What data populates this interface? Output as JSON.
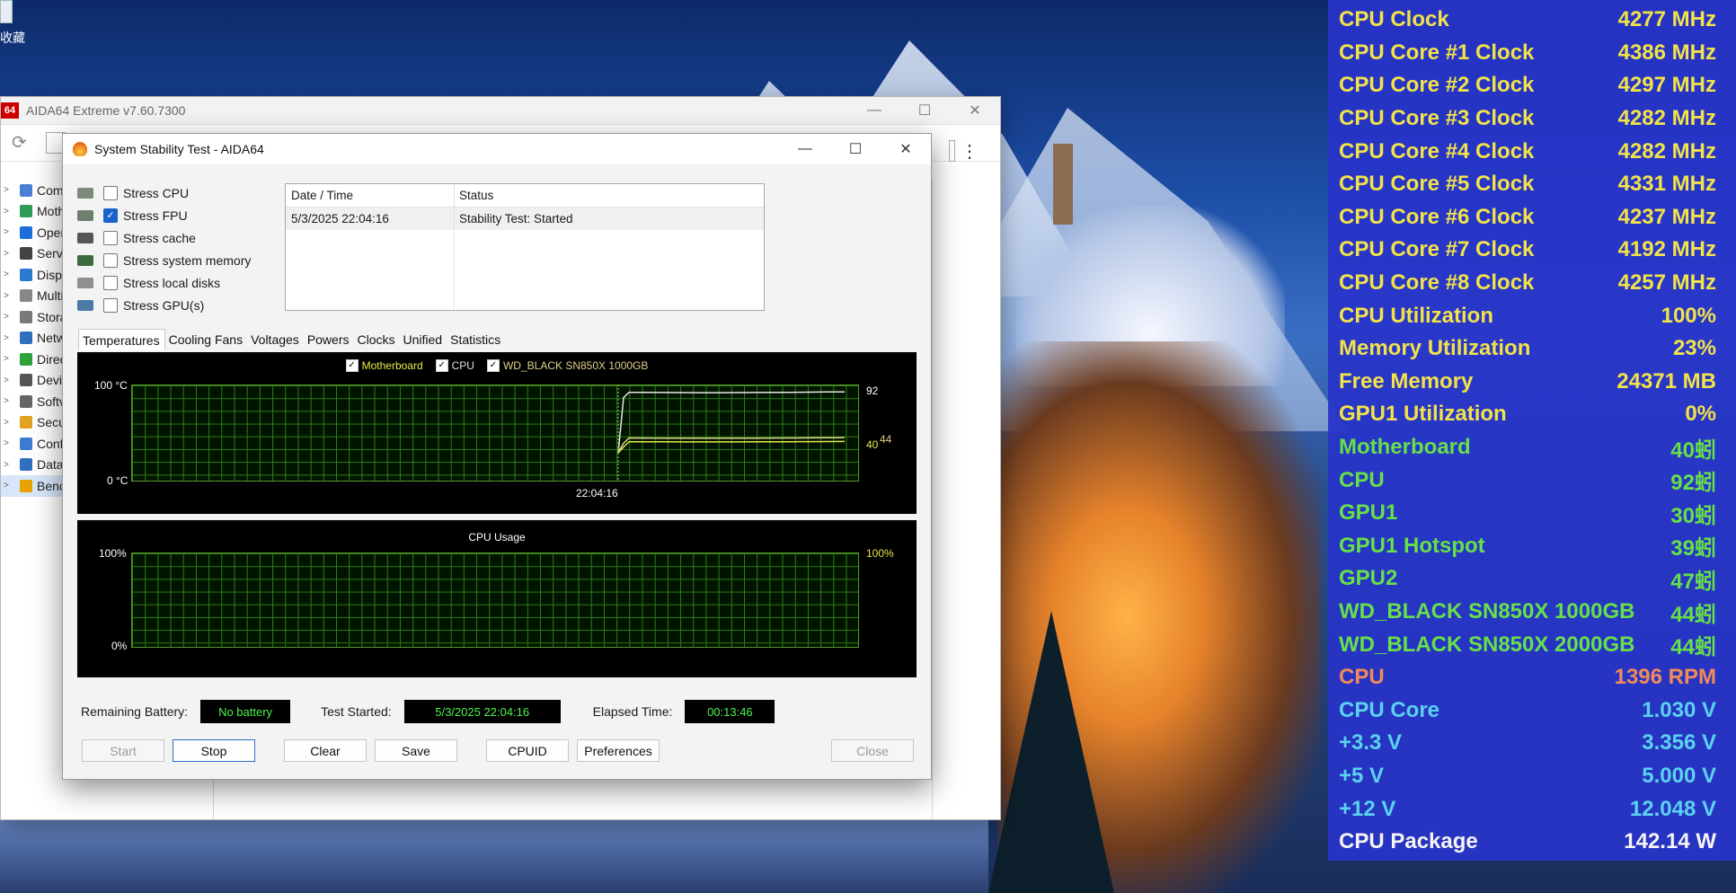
{
  "desktop": {
    "icon_label": "收藏"
  },
  "main_window": {
    "title": "AIDA64 Extreme v7.60.7300",
    "logo_text": "64",
    "tree_items": [
      "Com",
      "Moth",
      "Oper",
      "Serv",
      "Displ",
      "Multi",
      "Stora",
      "Netw",
      "Direc",
      "Devi",
      "Softv",
      "Secu",
      "Conf",
      "Data",
      "Benc"
    ]
  },
  "dialog": {
    "title": "System Stability Test - AIDA64",
    "options": [
      {
        "label": "Stress CPU",
        "checked": false
      },
      {
        "label": "Stress FPU",
        "checked": true
      },
      {
        "label": "Stress cache",
        "checked": false
      },
      {
        "label": "Stress system memory",
        "checked": false
      },
      {
        "label": "Stress local disks",
        "checked": false
      },
      {
        "label": "Stress GPU(s)",
        "checked": false
      }
    ],
    "log": {
      "col_datetime": "Date / Time",
      "col_status": "Status",
      "row_datetime": "5/3/2025 22:04:16",
      "row_status": "Stability Test: Started"
    },
    "tabs": [
      "Temperatures",
      "Cooling Fans",
      "Voltages",
      "Powers",
      "Clocks",
      "Unified",
      "Statistics"
    ],
    "temp_graph": {
      "legend": [
        "Motherboard",
        "CPU",
        "WD_BLACK SN850X 1000GB"
      ],
      "y_max": "100 °C",
      "y_min": "0 °C",
      "time": "22:04:16",
      "val_cpu": "92",
      "val_mb": "40",
      "val_ssd": "44",
      "colors": {
        "motherboard": "#e8e84a",
        "cpu": "#e0e0e0",
        "ssd": "#e0d08a"
      }
    },
    "usage_graph": {
      "title": "CPU Usage",
      "y_max": "100%",
      "y_min": "0%",
      "value": "100%"
    },
    "status": {
      "battery_label": "Remaining Battery:",
      "battery_value": "No battery",
      "started_label": "Test Started:",
      "started_value": "5/3/2025 22:04:16",
      "elapsed_label": "Elapsed Time:",
      "elapsed_value": "00:13:46"
    },
    "buttons": {
      "start": "Start",
      "stop": "Stop",
      "clear": "Clear",
      "save": "Save",
      "cpuid": "CPUID",
      "preferences": "Preferences",
      "close": "Close"
    }
  },
  "osd": [
    {
      "label": "CPU Clock",
      "value": "4277 MHz",
      "color": "#f2e24a"
    },
    {
      "label": "CPU Core #1 Clock",
      "value": "4386 MHz",
      "color": "#f2e24a"
    },
    {
      "label": "CPU Core #2 Clock",
      "value": "4297 MHz",
      "color": "#f2e24a"
    },
    {
      "label": "CPU Core #3 Clock",
      "value": "4282 MHz",
      "color": "#f2e24a"
    },
    {
      "label": "CPU Core #4 Clock",
      "value": "4282 MHz",
      "color": "#f2e24a"
    },
    {
      "label": "CPU Core #5 Clock",
      "value": "4331 MHz",
      "color": "#f2e24a"
    },
    {
      "label": "CPU Core #6 Clock",
      "value": "4237 MHz",
      "color": "#f2e24a"
    },
    {
      "label": "CPU Core #7 Clock",
      "value": "4192 MHz",
      "color": "#f2e24a"
    },
    {
      "label": "CPU Core #8 Clock",
      "value": "4257 MHz",
      "color": "#f2e24a"
    },
    {
      "label": "CPU Utilization",
      "value": "100%",
      "color": "#f2e24a"
    },
    {
      "label": "Memory Utilization",
      "value": "23%",
      "color": "#f2e24a"
    },
    {
      "label": "Free Memory",
      "value": "24371 MB",
      "color": "#f2e24a"
    },
    {
      "label": "GPU1 Utilization",
      "value": "0%",
      "color": "#f2e24a"
    },
    {
      "label": "Motherboard",
      "value": "40蚓",
      "color": "#66e04a"
    },
    {
      "label": "CPU",
      "value": "92蚓",
      "color": "#66e04a"
    },
    {
      "label": "GPU1",
      "value": "30蚓",
      "color": "#66e04a"
    },
    {
      "label": "GPU1 Hotspot",
      "value": "39蚓",
      "color": "#66e04a"
    },
    {
      "label": "GPU2",
      "value": "47蚓",
      "color": "#66e04a"
    },
    {
      "label": "WD_BLACK SN850X 1000GB",
      "value": "44蚓",
      "color": "#66e04a"
    },
    {
      "label": "WD_BLACK SN850X 2000GB",
      "value": "44蚓",
      "color": "#66e04a"
    },
    {
      "label": "CPU",
      "value": "1396 RPM",
      "color": "#f08a5a"
    },
    {
      "label": "CPU Core",
      "value": "1.030 V",
      "color": "#5ad2f0"
    },
    {
      "label": "+3.3 V",
      "value": "3.356 V",
      "color": "#5ad2f0"
    },
    {
      "label": "+5 V",
      "value": "5.000 V",
      "color": "#5ad2f0"
    },
    {
      "label": "+12 V",
      "value": "12.048 V",
      "color": "#5ad2f0"
    },
    {
      "label": "CPU Package",
      "value": "142.14 W",
      "color": "#f5f5f5"
    }
  ]
}
